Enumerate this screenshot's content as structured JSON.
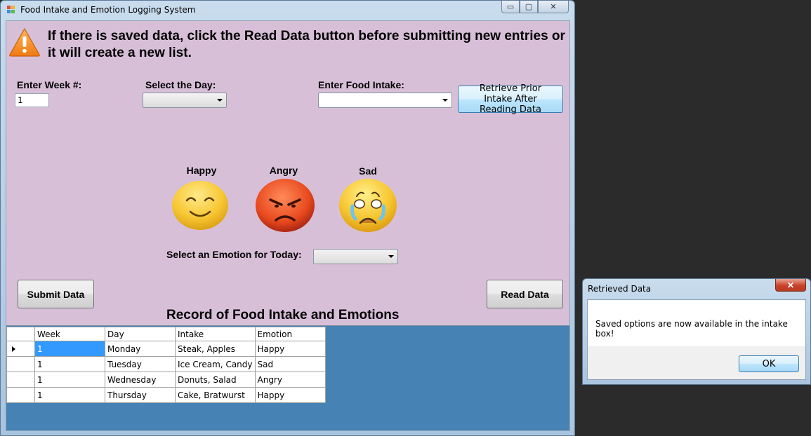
{
  "window": {
    "title": "Food Intake and Emotion Logging System",
    "minimize_glyph": "▭",
    "maximize_glyph": "▢",
    "close_glyph": "✕"
  },
  "warning": {
    "icon": "warning-icon",
    "text": "If there is saved data, click the Read Data button before submitting new entries or it will create a new list."
  },
  "form": {
    "week_label": "Enter Week #:",
    "week_value": "1",
    "day_label": "Select the Day:",
    "day_value": "",
    "food_label": "Enter Food Intake:",
    "food_value": "",
    "retrieve_button": "Retrieve Prior Intake After Reading Data"
  },
  "emotions": {
    "happy_label": "Happy",
    "angry_label": "Angry",
    "sad_label": "Sad",
    "select_label": "Select an Emotion for Today:",
    "select_value": ""
  },
  "buttons": {
    "submit": "Submit Data",
    "read": "Read Data"
  },
  "record": {
    "title": "Record of Food Intake and Emotions",
    "columns": [
      "Week",
      "Day",
      "Intake",
      "Emotion"
    ],
    "rows": [
      [
        "1",
        "Monday",
        "Steak, Apples",
        "Happy"
      ],
      [
        "1",
        "Tuesday",
        "Ice Cream, Candy",
        "Sad"
      ],
      [
        "1",
        "Wednesday",
        "Donuts, Salad",
        "Angry"
      ],
      [
        "1",
        "Thursday",
        "Cake, Bratwurst",
        "Happy"
      ]
    ]
  },
  "dialog": {
    "title": "Retrieved Data",
    "close_glyph": "✕",
    "message": "Saved options are now available in the intake box!",
    "ok": "OK"
  },
  "colors": {
    "client_bg": "#d8bfd8",
    "grid_bg": "#4682b4",
    "selection": "#3399ff"
  }
}
